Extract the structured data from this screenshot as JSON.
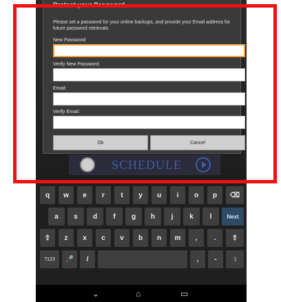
{
  "dialog": {
    "title": "Protect your Password",
    "message": "Please set a password for your online backups, and provide your Email address for future password retrievals.",
    "fields": [
      {
        "label": "New Password:",
        "value": ""
      },
      {
        "label": "Verify New Password:",
        "value": ""
      },
      {
        "label": "Email:",
        "value": ""
      },
      {
        "label": "Verify Email:",
        "value": ""
      }
    ],
    "ok_label": "Ok",
    "cancel_label": "Cancel"
  },
  "schedule_banner": {
    "label": "SCHEDULE"
  },
  "keyboard": {
    "row1": [
      "q",
      "w",
      "e",
      "r",
      "t",
      "y",
      "u",
      "i",
      "o",
      "p",
      "⌫"
    ],
    "row2": [
      "a",
      "s",
      "d",
      "f",
      "g",
      "h",
      "j",
      "k",
      "l",
      "Next"
    ],
    "row3": [
      "⇧",
      "z",
      "x",
      "c",
      "v",
      "b",
      "n",
      "m",
      ",",
      ".",
      "⇧"
    ],
    "row4": [
      "?123",
      "🎤",
      "/",
      "",
      ",",
      "-",
      ":)"
    ]
  },
  "navbar": {
    "back": "⌄",
    "home": "⌂",
    "recents": "▭"
  },
  "colors": {
    "highlight_frame": "#ee1111",
    "focus": "#f2a33a",
    "next_key": "#2f4a63"
  }
}
